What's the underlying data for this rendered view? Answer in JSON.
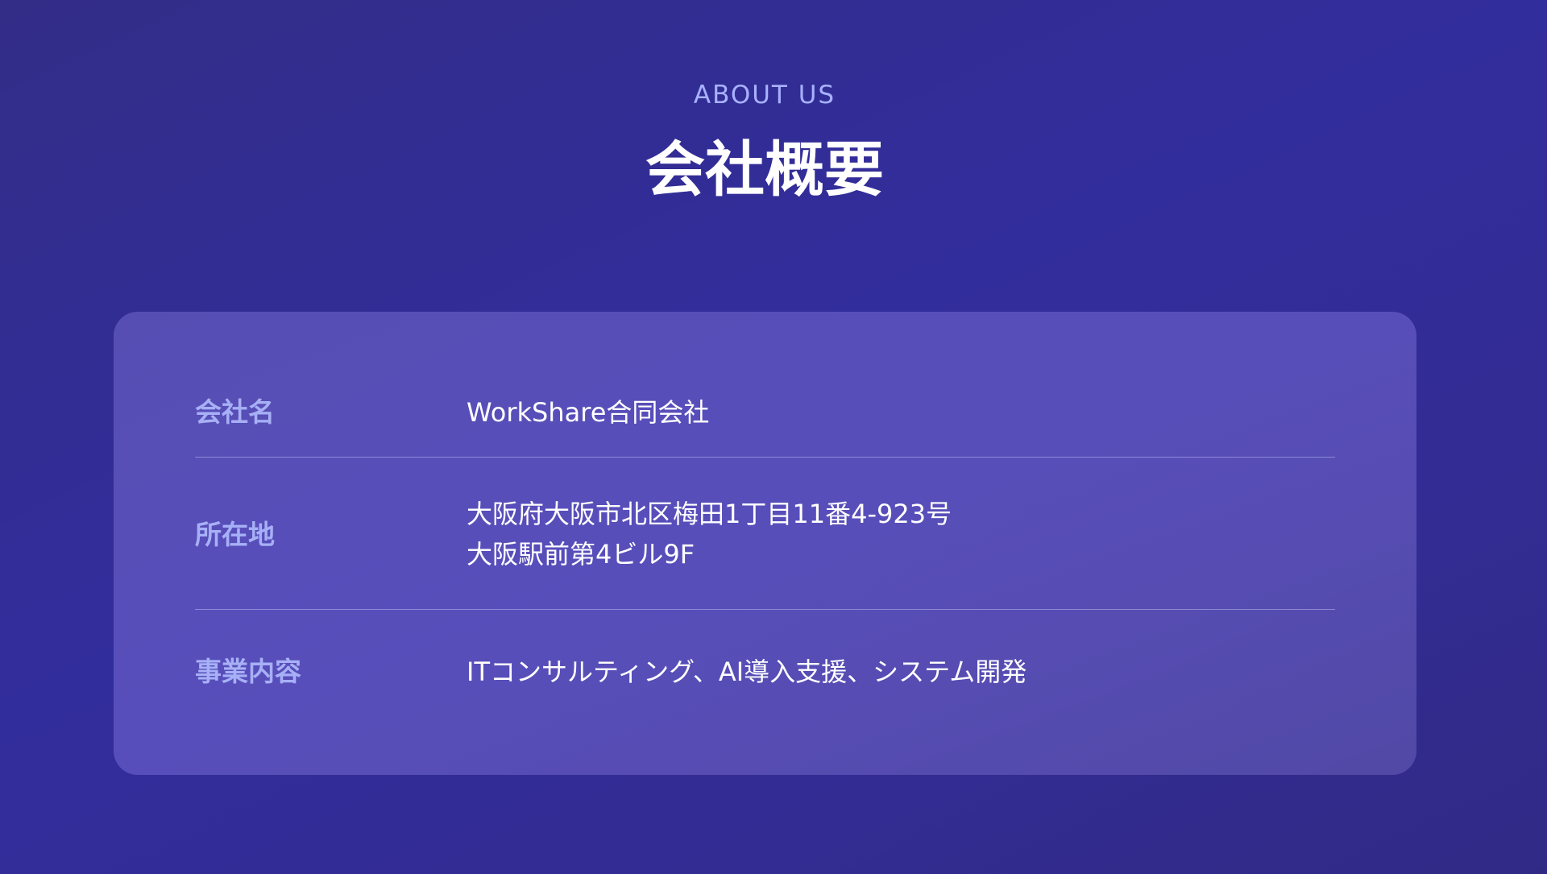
{
  "header": {
    "eyebrow": "ABOUT US",
    "title": "会社概要"
  },
  "company_info": {
    "rows": [
      {
        "label": "会社名",
        "value_lines": [
          "WorkShare合同会社"
        ]
      },
      {
        "label": "所在地",
        "value_lines": [
          "大阪府大阪市北区梅田1丁目11番4-923号",
          "大阪駅前第4ビル9F"
        ]
      },
      {
        "label": "事業内容",
        "value_lines": [
          "ITコンサルティング、AI導入支援、システム開発"
        ]
      }
    ]
  },
  "colors": {
    "accent": "#a8b1ff",
    "background": "#322d9c",
    "text": "#ffffff"
  }
}
